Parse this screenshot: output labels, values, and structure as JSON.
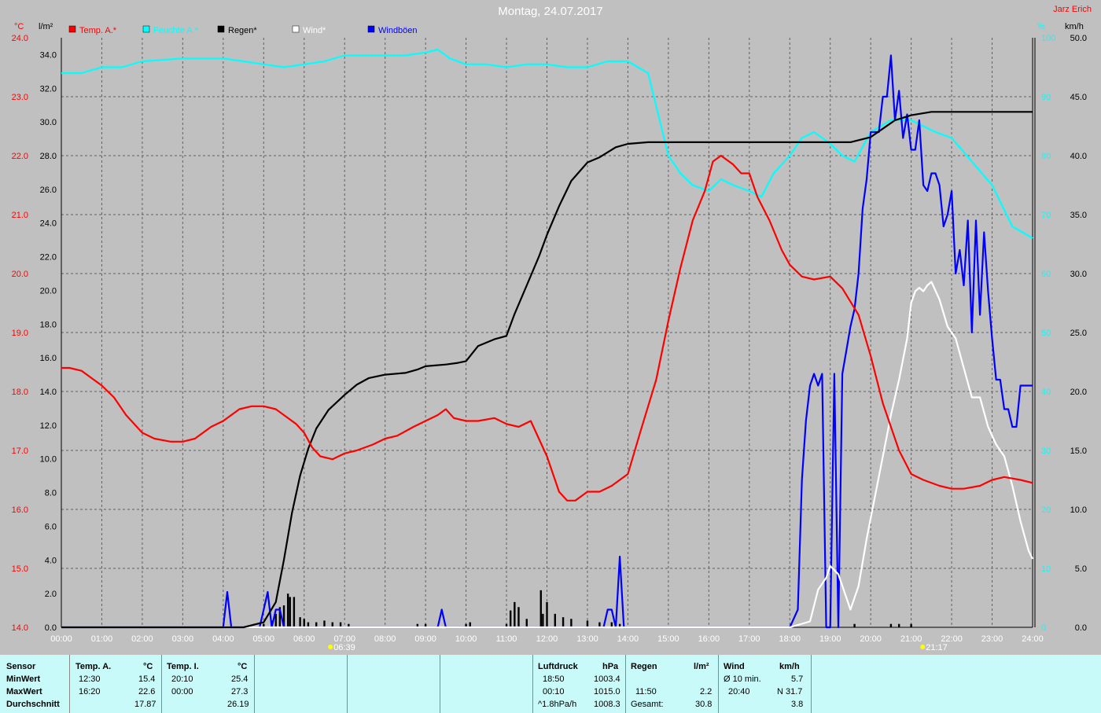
{
  "header": {
    "title": "Montag, 24.07.2017",
    "author": "Jarz Erich"
  },
  "units": {
    "left_temp": "°C",
    "left_rain": "l/m²",
    "right_pct": "%",
    "right_wind": "km/h"
  },
  "legend": [
    {
      "label": "Temp. A.*",
      "color": "#ff0000"
    },
    {
      "label": "Feuchte A.*",
      "color": "#00ffff"
    },
    {
      "label": "Regen*",
      "color": "#000000"
    },
    {
      "label": "Wind*",
      "color": "#ffffff"
    },
    {
      "label": "Windböen",
      "color": "#0000ff"
    }
  ],
  "markers": {
    "sunrise": "06:39",
    "sunset": "21:17"
  },
  "colors": {
    "temp": "#ff0000",
    "humidity": "#00ffff",
    "rain": "#000000",
    "wind": "#ffffff",
    "gusts": "#0000ff",
    "background": "#c0c0c0",
    "grid": "#606060",
    "table": "#c8fafa"
  },
  "chart_data": {
    "type": "line",
    "x_ticks": [
      "00:00",
      "01:00",
      "02:00",
      "03:00",
      "04:00",
      "05:00",
      "06:00",
      "07:00",
      "08:00",
      "09:00",
      "10:00",
      "11:00",
      "12:00",
      "13:00",
      "14:00",
      "15:00",
      "16:00",
      "17:00",
      "18:00",
      "19:00",
      "20:00",
      "21:00",
      "22:00",
      "23:00",
      "24:00"
    ],
    "axes": {
      "temp": {
        "ticks": [
          "14.0",
          "15.0",
          "16.0",
          "17.0",
          "18.0",
          "19.0",
          "20.0",
          "21.0",
          "22.0",
          "23.0",
          "24.0"
        ],
        "ylim": [
          14,
          24
        ]
      },
      "rain": {
        "ticks": [
          "0.0",
          "2.0",
          "4.0",
          "6.0",
          "8.0",
          "10.0",
          "12.0",
          "14.0",
          "16.0",
          "18.0",
          "20.0",
          "22.0",
          "24.0",
          "26.0",
          "28.0",
          "30.0",
          "32.0",
          "34.0"
        ],
        "ylim": [
          0,
          35
        ]
      },
      "pct": {
        "ticks": [
          "0",
          "10",
          "20",
          "30",
          "40",
          "50",
          "60",
          "70",
          "80",
          "90",
          "100"
        ],
        "ylim": [
          0,
          100
        ]
      },
      "wind": {
        "ticks": [
          "0.0",
          "5.0",
          "10.0",
          "15.0",
          "20.0",
          "25.0",
          "30.0",
          "35.0",
          "40.0",
          "45.0",
          "50.0"
        ],
        "ylim": [
          0,
          50
        ]
      }
    },
    "series": [
      {
        "name": "Temp. A.*",
        "axis": "temp",
        "color": "#ff0000",
        "x": [
          0,
          0.2,
          0.5,
          0.8,
          1.0,
          1.3,
          1.6,
          2.0,
          2.3,
          2.7,
          3.0,
          3.3,
          3.7,
          4.0,
          4.2,
          4.4,
          4.7,
          5.0,
          5.3,
          5.5,
          5.8,
          6.0,
          6.2,
          6.4,
          6.7,
          7.0,
          7.3,
          7.7,
          8.0,
          8.3,
          8.7,
          9.0,
          9.3,
          9.5,
          9.7,
          10.0,
          10.3,
          10.7,
          11.0,
          11.3,
          11.6,
          11.8,
          12.0,
          12.3,
          12.5,
          12.7,
          13.0,
          13.3,
          13.6,
          14.0,
          14.3,
          14.7,
          15.0,
          15.3,
          15.6,
          15.9,
          16.1,
          16.3,
          16.6,
          16.8,
          17.0,
          17.2,
          17.5,
          17.8,
          18.0,
          18.3,
          18.6,
          19.0,
          19.3,
          19.7,
          20.0,
          20.3,
          20.7,
          21.0,
          21.3,
          21.7,
          22.0,
          22.3,
          22.7,
          23.0,
          23.3,
          23.7,
          24.0
        ],
        "y": [
          18.4,
          18.4,
          18.35,
          18.2,
          18.1,
          17.9,
          17.6,
          17.3,
          17.2,
          17.15,
          17.15,
          17.2,
          17.4,
          17.5,
          17.6,
          17.7,
          17.75,
          17.75,
          17.7,
          17.6,
          17.45,
          17.3,
          17.05,
          16.9,
          16.85,
          16.95,
          17.0,
          17.1,
          17.2,
          17.25,
          17.4,
          17.5,
          17.6,
          17.7,
          17.55,
          17.5,
          17.5,
          17.55,
          17.45,
          17.4,
          17.5,
          17.2,
          16.9,
          16.3,
          16.15,
          16.15,
          16.3,
          16.3,
          16.4,
          16.6,
          17.3,
          18.2,
          19.2,
          20.1,
          20.9,
          21.4,
          21.9,
          22.0,
          21.85,
          21.7,
          21.7,
          21.3,
          20.9,
          20.4,
          20.15,
          19.95,
          19.9,
          19.95,
          19.75,
          19.3,
          18.6,
          17.8,
          17.0,
          16.6,
          16.5,
          16.4,
          16.35,
          16.35,
          16.4,
          16.5,
          16.55,
          16.5,
          16.45
        ]
      },
      {
        "name": "Feuchte A.*",
        "axis": "pct",
        "color": "#00ffff",
        "x": [
          0,
          0.5,
          1.0,
          1.5,
          2.0,
          3.0,
          4.0,
          4.5,
          5.0,
          5.5,
          6.0,
          6.5,
          7.0,
          7.5,
          8.0,
          8.5,
          9.0,
          9.3,
          9.6,
          10.0,
          10.5,
          11.0,
          11.5,
          12.0,
          12.5,
          13.0,
          13.5,
          14.0,
          14.5,
          15.0,
          15.3,
          15.6,
          16.0,
          16.3,
          16.6,
          17.0,
          17.3,
          17.6,
          18.0,
          18.3,
          18.6,
          19.0,
          19.3,
          19.6,
          20.0,
          20.5,
          21.0,
          21.3,
          21.6,
          22.0,
          22.5,
          23.0,
          23.5,
          24.0
        ],
        "y": [
          94,
          94,
          95,
          95,
          96,
          96.5,
          96.5,
          96,
          95.5,
          95,
          95.5,
          96,
          97,
          97,
          97,
          97,
          97.5,
          98,
          96.5,
          95.5,
          95.5,
          95,
          95.5,
          95.5,
          95,
          95,
          96,
          96,
          94,
          80,
          77,
          75,
          74,
          76,
          75,
          74,
          73,
          77,
          80,
          83,
          84,
          82,
          80,
          79,
          84,
          86,
          86,
          85,
          84,
          83,
          79,
          75,
          68,
          66
        ]
      },
      {
        "name": "Regen*",
        "axis": "rain",
        "color": "#000000",
        "x": [
          0,
          4.5,
          5.0,
          5.3,
          5.5,
          5.7,
          5.9,
          6.1,
          6.3,
          6.6,
          7.0,
          7.3,
          7.6,
          8.0,
          8.5,
          8.8,
          9.0,
          9.5,
          9.8,
          10.0,
          10.3,
          10.7,
          11.0,
          11.2,
          11.5,
          11.8,
          12.0,
          12.3,
          12.6,
          13.0,
          13.3,
          13.7,
          14.0,
          14.5,
          15.0,
          16.0,
          17.0,
          18.0,
          19.0,
          19.5,
          20.0,
          20.3,
          20.6,
          21.0,
          21.5,
          22.0,
          23.0,
          24.0
        ],
        "y": [
          0,
          0,
          0.3,
          1.5,
          4.0,
          6.8,
          9.0,
          10.6,
          11.8,
          12.9,
          13.8,
          14.4,
          14.8,
          15.0,
          15.1,
          15.3,
          15.5,
          15.6,
          15.7,
          15.8,
          16.7,
          17.1,
          17.3,
          18.6,
          20.3,
          22.0,
          23.3,
          25.0,
          26.5,
          27.6,
          27.9,
          28.5,
          28.7,
          28.8,
          28.8,
          28.8,
          28.8,
          28.8,
          28.8,
          28.8,
          29.1,
          29.6,
          30.1,
          30.4,
          30.6,
          30.6,
          30.6,
          30.6
        ]
      },
      {
        "name": "Wind*",
        "axis": "wind",
        "color": "#ffffff",
        "x": [
          0,
          18.0,
          18.5,
          18.7,
          18.9,
          19.0,
          19.2,
          19.4,
          19.5,
          19.7,
          19.9,
          20.1,
          20.3,
          20.5,
          20.7,
          20.9,
          21.0,
          21.1,
          21.2,
          21.3,
          21.4,
          21.5,
          21.7,
          21.9,
          22.1,
          22.3,
          22.5,
          22.7,
          22.9,
          23.1,
          23.3,
          23.5,
          23.7,
          23.9,
          24.0
        ],
        "y": [
          0,
          0,
          0.5,
          3.2,
          4.2,
          5.2,
          4.5,
          2.5,
          1.5,
          3.5,
          7.5,
          11.0,
          14.5,
          18.0,
          21.0,
          24.5,
          27.5,
          28.5,
          28.8,
          28.5,
          29.0,
          29.3,
          27.8,
          25.5,
          24.5,
          22.0,
          19.5,
          19.5,
          17.0,
          15.5,
          14.5,
          12.0,
          9.0,
          6.5,
          5.8
        ]
      },
      {
        "name": "Windböen",
        "axis": "wind",
        "color": "#0000ff",
        "x": [
          0,
          4.0,
          4.1,
          4.2,
          4.3,
          4.9,
          5.0,
          5.1,
          5.2,
          5.3,
          5.4,
          5.5,
          9.3,
          9.4,
          9.5,
          13.4,
          13.5,
          13.6,
          13.7,
          13.8,
          13.9,
          18.0,
          18.2,
          18.3,
          18.4,
          18.5,
          18.6,
          18.7,
          18.8,
          18.9,
          19.0,
          19.1,
          19.2,
          19.3,
          19.4,
          19.5,
          19.6,
          19.7,
          19.8,
          19.9,
          20.0,
          20.2,
          20.3,
          20.4,
          20.5,
          20.6,
          20.7,
          20.8,
          20.9,
          21.0,
          21.1,
          21.2,
          21.3,
          21.4,
          21.5,
          21.6,
          21.7,
          21.8,
          21.9,
          22.0,
          22.1,
          22.2,
          22.3,
          22.4,
          22.5,
          22.6,
          22.7,
          22.8,
          22.9,
          23.0,
          23.1,
          23.2,
          23.3,
          23.4,
          23.5,
          23.6,
          23.7,
          23.8,
          23.9,
          24.0
        ],
        "y": [
          0,
          0,
          3.0,
          0,
          0,
          0,
          1.5,
          3.0,
          0,
          1.5,
          1.5,
          0,
          0,
          1.5,
          0,
          0,
          1.5,
          1.5,
          0,
          6.0,
          0,
          0,
          1.5,
          12.5,
          17.5,
          20.5,
          21.5,
          20.5,
          21.5,
          0,
          0,
          21.5,
          0,
          21.5,
          23.5,
          25.5,
          27.0,
          30.0,
          35.5,
          38.0,
          42.0,
          42.0,
          45.0,
          45.0,
          48.5,
          43.0,
          45.5,
          41.5,
          43.5,
          40.5,
          40.5,
          43.0,
          37.5,
          37.0,
          38.5,
          38.5,
          37.5,
          34.0,
          35.0,
          37.0,
          30.0,
          32.0,
          29.0,
          34.5,
          25.0,
          34.5,
          26.5,
          33.5,
          28.5,
          24.5,
          21.0,
          21.0,
          18.5,
          18.5,
          17.0,
          17.0,
          20.5,
          20.5,
          20.5,
          20.5
        ]
      }
    ],
    "rain_bars": [
      {
        "x": 5.0,
        "y": 0.2
      },
      {
        "x": 5.2,
        "y": 0.4
      },
      {
        "x": 5.3,
        "y": 0.8
      },
      {
        "x": 5.4,
        "y": 1.2
      },
      {
        "x": 5.5,
        "y": 1.3
      },
      {
        "x": 5.6,
        "y": 2.0
      },
      {
        "x": 5.65,
        "y": 1.8
      },
      {
        "x": 5.75,
        "y": 1.8
      },
      {
        "x": 5.9,
        "y": 0.6
      },
      {
        "x": 6.0,
        "y": 0.5
      },
      {
        "x": 6.1,
        "y": 0.3
      },
      {
        "x": 6.3,
        "y": 0.3
      },
      {
        "x": 6.5,
        "y": 0.4
      },
      {
        "x": 6.7,
        "y": 0.3
      },
      {
        "x": 6.9,
        "y": 0.3
      },
      {
        "x": 7.1,
        "y": 0.2
      },
      {
        "x": 8.8,
        "y": 0.2
      },
      {
        "x": 9.0,
        "y": 0.2
      },
      {
        "x": 10.0,
        "y": 0.2
      },
      {
        "x": 10.1,
        "y": 0.3
      },
      {
        "x": 11.0,
        "y": 0.2
      },
      {
        "x": 11.1,
        "y": 1.0
      },
      {
        "x": 11.2,
        "y": 1.5
      },
      {
        "x": 11.3,
        "y": 1.2
      },
      {
        "x": 11.5,
        "y": 0.5
      },
      {
        "x": 11.85,
        "y": 2.2
      },
      {
        "x": 11.9,
        "y": 0.8
      },
      {
        "x": 12.0,
        "y": 1.5
      },
      {
        "x": 12.2,
        "y": 0.8
      },
      {
        "x": 12.4,
        "y": 0.6
      },
      {
        "x": 12.6,
        "y": 0.5
      },
      {
        "x": 13.0,
        "y": 0.4
      },
      {
        "x": 13.3,
        "y": 0.3
      },
      {
        "x": 13.6,
        "y": 0.3
      },
      {
        "x": 13.8,
        "y": 0.2
      },
      {
        "x": 19.6,
        "y": 0.2
      },
      {
        "x": 20.5,
        "y": 0.2
      },
      {
        "x": 20.7,
        "y": 0.2
      },
      {
        "x": 21.0,
        "y": 0.2
      }
    ]
  },
  "table": {
    "row_labels": [
      "Sensor",
      "MinWert",
      "MaxWert",
      "Durchschnitt"
    ],
    "temp_a": {
      "title": "Temp. A.",
      "unit": "°C",
      "min_time": "12:30",
      "min": "15.4",
      "max_time": "16:20",
      "max": "22.6",
      "avg": "17.87"
    },
    "temp_i": {
      "title": "Temp. I.",
      "unit": "°C",
      "min_time": "20:10",
      "min": "25.4",
      "max_time": "00:00",
      "max": "27.3",
      "avg": "26.19"
    },
    "pressure": {
      "title": "Luftdruck",
      "unit": "hPa",
      "min_time": "18:50",
      "min": "1003.4",
      "max_time": "00:10",
      "max": "1015.0",
      "trend": "^1.8hPa/h",
      "avg": "1008.3"
    },
    "rain": {
      "title": "Regen",
      "unit": "l/m²",
      "max_time": "11:50",
      "max": "2.2",
      "total_label": "Gesamt:",
      "total": "30.8"
    },
    "wind": {
      "title": "Wind",
      "unit": "km/h",
      "min_label": "Ø 10 min.",
      "min": "5.7",
      "max_time": "20:40",
      "max": "N 31.7",
      "avg": "3.8"
    }
  }
}
